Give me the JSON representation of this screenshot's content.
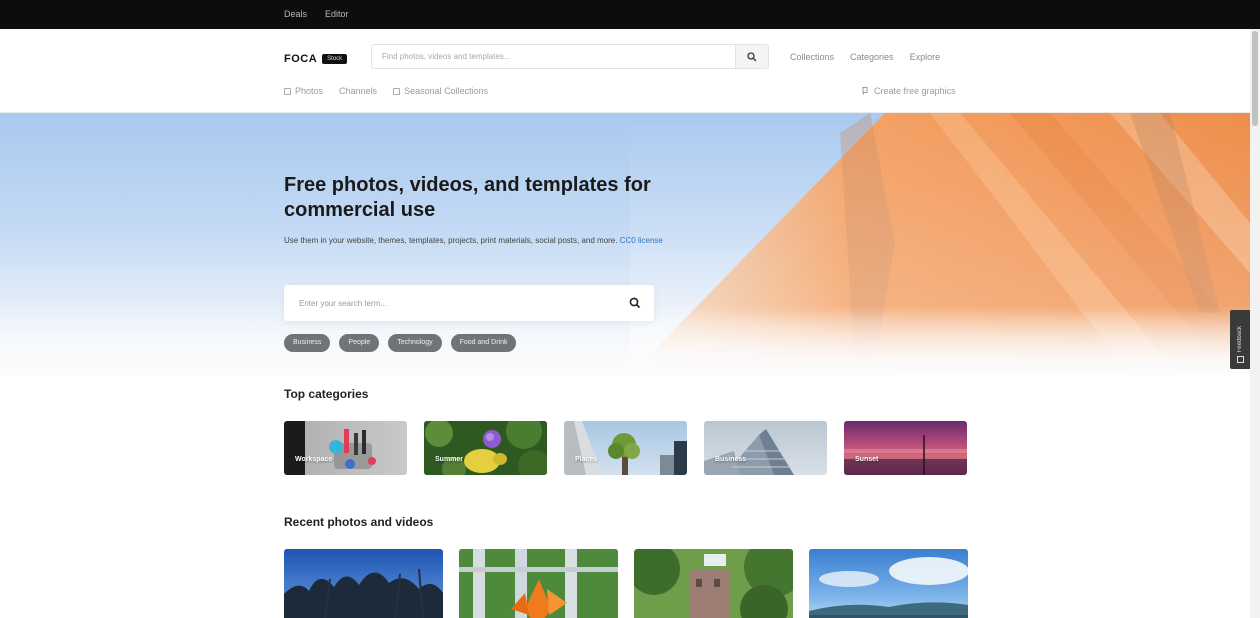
{
  "topbar": {
    "links": [
      "Deals",
      "Editor"
    ]
  },
  "header": {
    "logo": {
      "word": "FOCA",
      "badge": "Stock"
    },
    "search": {
      "placeholder": "Find photos, videos and templates..."
    },
    "nav": [
      "Collections",
      "Categories",
      "Explore"
    ],
    "subnav": [
      "Photos",
      "Channels",
      "Seasonal Collections"
    ],
    "cta": "Create free graphics"
  },
  "hero": {
    "title": "Free photos, videos, and templates for commercial use",
    "description": "Use them in your website, themes, templates, projects, print materials, social posts, and more.",
    "license_link": "CC0 license",
    "search_placeholder": "Enter your search term...",
    "chips": [
      "Business",
      "People",
      "Technology",
      "Food and Drink"
    ]
  },
  "sections": {
    "top_categories": "Top categories",
    "recent": "Recent photos and videos"
  },
  "categories": [
    {
      "label": "Workspace"
    },
    {
      "label": "Summer"
    },
    {
      "label": "Places"
    },
    {
      "label": "Business"
    },
    {
      "label": "Sunset"
    }
  ],
  "feedback": {
    "label": "Feedback"
  },
  "colors": {
    "topbar": "#0d0d0d",
    "chip": "#707477",
    "link": "#2f74c0",
    "hero_sky": "#a9c9ef",
    "hero_accent": "#f39a5a"
  }
}
